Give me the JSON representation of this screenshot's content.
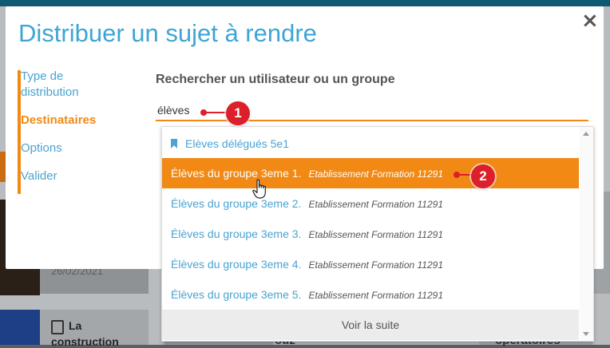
{
  "background": {
    "date_text": "26/02/2021",
    "card_title_line1": "La",
    "card_title_line2": "construction",
    "fragment_left": "ouz",
    "fragment_right": "opératoires"
  },
  "modal": {
    "title": "Distribuer un sujet à rendre",
    "close_icon": "close-icon"
  },
  "steps": [
    {
      "label": "Type de distribution",
      "active": false
    },
    {
      "label": "Destinataires",
      "active": true
    },
    {
      "label": "Options",
      "active": false
    },
    {
      "label": "Valider",
      "active": false
    }
  ],
  "search": {
    "label": "Rechercher un utilisateur ou un groupe",
    "value": "élèves"
  },
  "dropdown": {
    "items": [
      {
        "name": "Elèves délégués 5e1",
        "org": "",
        "icon": "bookmark-icon"
      },
      {
        "name": "Élèves du groupe 3eme 1.",
        "org": "Etablissement Formation 11291",
        "selected": true
      },
      {
        "name": "Élèves du groupe 3eme 2.",
        "org": "Etablissement Formation 11291"
      },
      {
        "name": "Élèves du groupe 3eme 3.",
        "org": "Etablissement Formation 11291"
      },
      {
        "name": "Élèves du groupe 3eme 4.",
        "org": "Etablissement Formation 11291"
      },
      {
        "name": "Élèves du groupe 3eme 5.",
        "org": "Etablissement Formation 11291"
      }
    ],
    "see_more_label": "Voir la suite"
  },
  "annotations": [
    {
      "number": "1",
      "target": "search input"
    },
    {
      "number": "2",
      "target": "selected dropdown item"
    }
  ],
  "colors": {
    "accent_orange": "#f18914",
    "link_blue": "#4aa3d2",
    "annotation_red": "#dd1f2b"
  }
}
